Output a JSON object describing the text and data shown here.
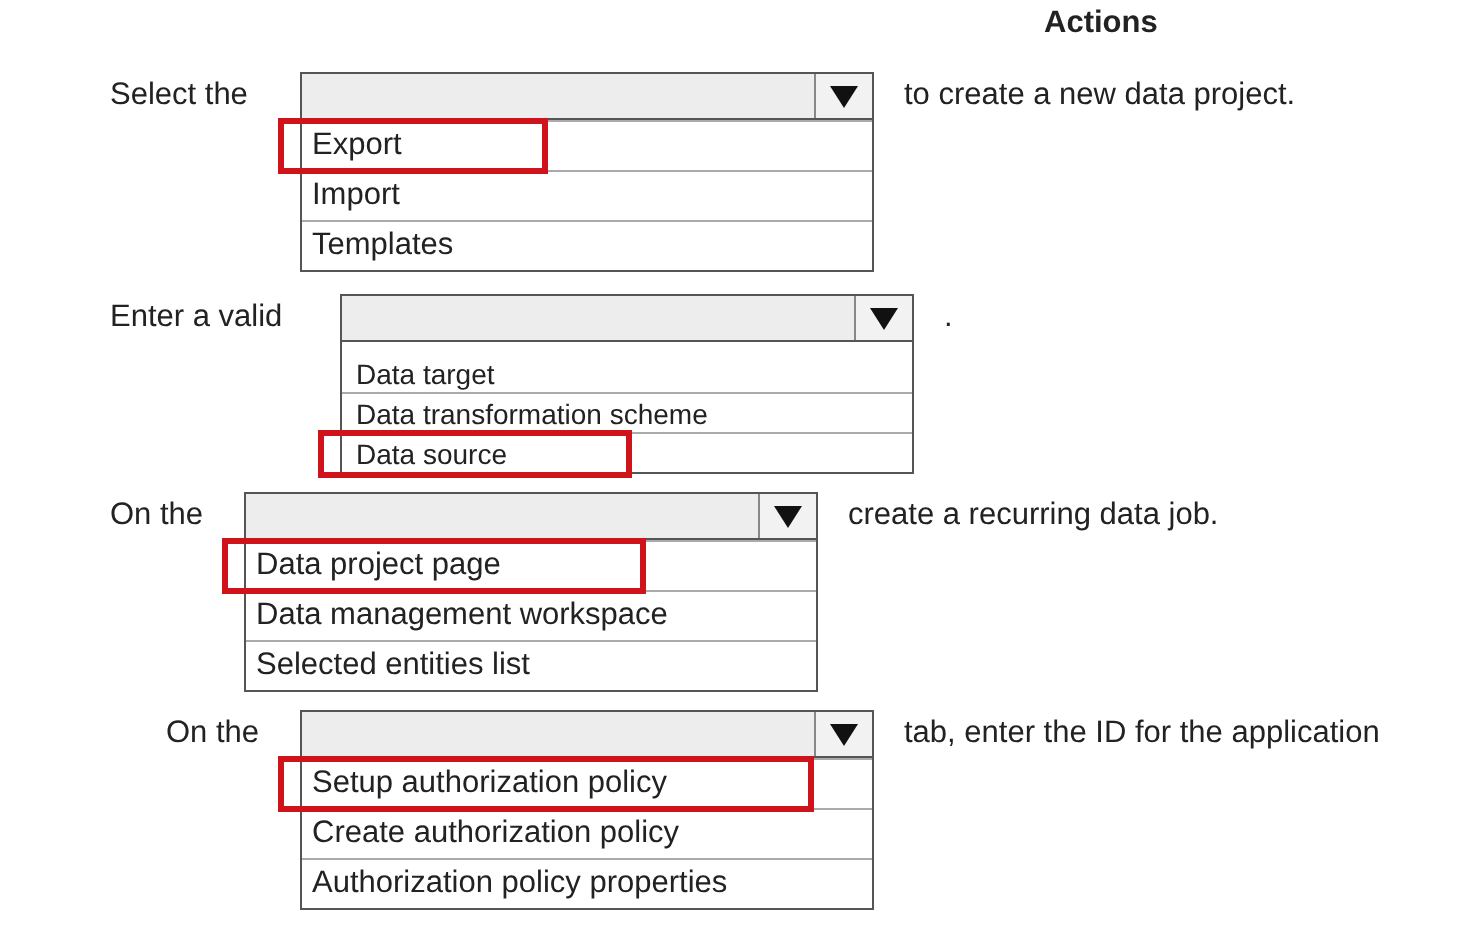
{
  "header": "Actions",
  "questions": [
    {
      "kind": "standard",
      "prefix": "Select the",
      "suffix": "to create a new data project.",
      "options": [
        {
          "label": "Export",
          "selected": true
        },
        {
          "label": "Import",
          "selected": false
        },
        {
          "label": "Templates",
          "selected": false
        }
      ]
    },
    {
      "kind": "compact",
      "prefix": "Enter a valid",
      "suffix": ".",
      "options": [
        {
          "label": "Data target",
          "selected": false
        },
        {
          "label": "Data transformation scheme",
          "selected": false
        },
        {
          "label": "Data source",
          "selected": true
        }
      ]
    },
    {
      "kind": "standard",
      "prefix": "On the",
      "suffix": "create a recurring data job.",
      "options": [
        {
          "label": "Data project page",
          "selected": true
        },
        {
          "label": "Data management workspace",
          "selected": false
        },
        {
          "label": "Selected entities list",
          "selected": false
        }
      ]
    },
    {
      "kind": "standard",
      "prefix": "On the",
      "suffix": "tab, enter the ID for the application",
      "options": [
        {
          "label": "Setup authorization policy",
          "selected": true
        },
        {
          "label": "Create authorization policy",
          "selected": false
        },
        {
          "label": "Authorization policy properties",
          "selected": false
        }
      ]
    }
  ]
}
